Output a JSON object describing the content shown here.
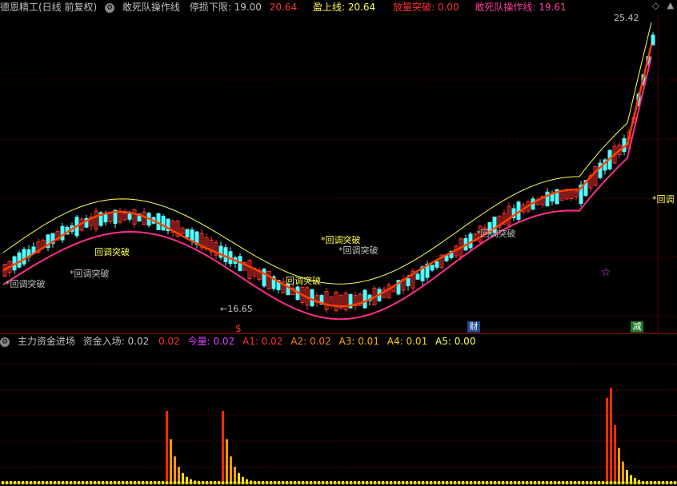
{
  "header": {
    "stock_name": "德恩精工(日线 前复权)",
    "indicator_name": "敢死队操作线",
    "stop_loss_label": "停损下限:",
    "stop_loss_value": "19.00",
    "value_red": "20.64",
    "profit_label": "盈上线:",
    "profit_value": "20.64",
    "volume_break": "放量突破: 0.00",
    "dare_line": "敢死队操作线: 19.61"
  },
  "price_labels": {
    "high": "25.42",
    "low": "←16.65"
  },
  "annotations": [
    "*回调突破",
    "*回调突破",
    "回调突破",
    "回调突破",
    "*回调突破",
    "*回调突破",
    "*回调"
  ],
  "markers": {
    "money_icon": "$",
    "caibao": "财",
    "jian": "减"
  },
  "lower": {
    "title": "主力资金进场",
    "fund_in": "资金入场: 0.02",
    "value2": "0.02",
    "jinliang": "今量: 0.02",
    "a1": "A1: 0.02",
    "a2": "A2: 0.02",
    "a3": "A3: 0.01",
    "a4": "A4: 0.01",
    "a5": "A5: 0.00"
  },
  "colors": {
    "up": "#ff3232",
    "down": "#54ffff",
    "ma_orange": "#ff4000",
    "ma_magenta": "#ff2d8c",
    "ma_yellow": "#ffff54",
    "text_yellow": "#ffff54"
  }
}
